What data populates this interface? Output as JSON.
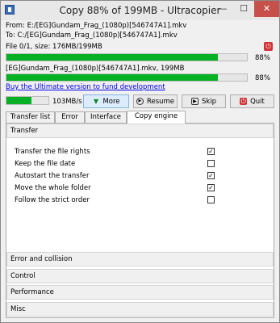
{
  "window": {
    "title": "Copy 88% of 199MB - Ultracopier",
    "minimize_glyph": "—",
    "maximize_glyph": "☐",
    "close_glyph": "✕"
  },
  "transfer": {
    "from_line": "From: E:/[EG]Gundam_Frag_(1080p)[546747A1].mkv",
    "to_line": "To:  C:/[EG]Gundam_Frag_(1080p)[546747A1].mkv",
    "file_line": "File 0/1, size: 176MB/199MB",
    "overall_progress_percent": 88,
    "overall_progress_label": "88%",
    "current_file_line": "[EG]Gundam_Frag_(1080p)[546747A1].mkv, 199MB",
    "file_progress_percent": 88,
    "file_progress_label": "88%",
    "stop_glyph": "⏻"
  },
  "promo_link": "Buy the Ultimate version to fund development",
  "speed": {
    "label": "103MB/s",
    "level_percent": 60
  },
  "buttons": {
    "more": "More",
    "more_glyph": "▼",
    "resume": "Resume",
    "resume_glyph": "▶",
    "skip": "Skip",
    "skip_glyph": "▶",
    "quit": "Quit",
    "quit_glyph": "⏻"
  },
  "tabs": [
    {
      "label": "Transfer list"
    },
    {
      "label": "Error"
    },
    {
      "label": "Interface"
    },
    {
      "label": "Copy engine"
    }
  ],
  "active_tab": "Copy engine",
  "sections": {
    "transfer": "Transfer",
    "error_collision": "Error and collision",
    "control": "Control",
    "performance": "Performance",
    "misc": "Misc"
  },
  "options": [
    {
      "label": "Transfer the file rights",
      "checked": true
    },
    {
      "label": "Keep the file date",
      "checked": false
    },
    {
      "label": "Autostart the transfer",
      "checked": true
    },
    {
      "label": "Move the whole folder",
      "checked": true
    },
    {
      "label": "Follow the strict order",
      "checked": false
    }
  ],
  "check_glyph": "✓",
  "colors": {
    "progress_fill": "#06b025",
    "close_button": "#c7514a",
    "link": "#0000ee",
    "more_button_bg": "#dcecfc"
  }
}
